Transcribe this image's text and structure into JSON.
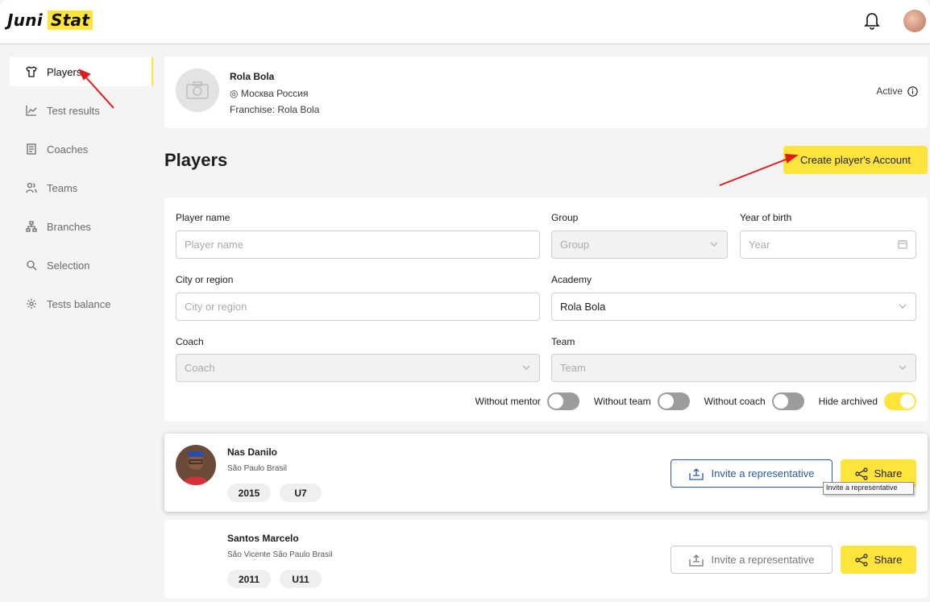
{
  "app": {
    "logo_part1": "Juni",
    "logo_part2": "Stat"
  },
  "topbar": {
    "bell_icon": "bell-icon",
    "avatar_icon": "user-avatar"
  },
  "sidebar": {
    "items": [
      {
        "label": "Players",
        "icon": "shirt-icon",
        "active": true
      },
      {
        "label": "Test results",
        "icon": "chart-line-icon"
      },
      {
        "label": "Coaches",
        "icon": "clipboard-icon"
      },
      {
        "label": "Teams",
        "icon": "users-icon"
      },
      {
        "label": "Branches",
        "icon": "hierarchy-icon"
      },
      {
        "label": "Selection",
        "icon": "search-icon"
      },
      {
        "label": "Tests balance",
        "icon": "gear-icon"
      }
    ]
  },
  "academy": {
    "name": "Rola Bola",
    "location": "Москва Россия",
    "franchise": "Franchise: Rola Bola",
    "status": "Active"
  },
  "page": {
    "title": "Players",
    "create_button": "Create player's Account"
  },
  "filters": {
    "player_name": {
      "label": "Player name",
      "placeholder": "Player name"
    },
    "group": {
      "label": "Group",
      "placeholder": "Group"
    },
    "year_of_birth": {
      "label": "Year of birth",
      "placeholder": "Year"
    },
    "city": {
      "label": "City or region",
      "placeholder": "City or region"
    },
    "academy": {
      "label": "Academy",
      "value": "Rola Bola"
    },
    "coach": {
      "label": "Coach",
      "placeholder": "Coach"
    },
    "team": {
      "label": "Team",
      "placeholder": "Team"
    },
    "toggles": [
      {
        "label": "Without mentor",
        "on": false
      },
      {
        "label": "Without team",
        "on": false
      },
      {
        "label": "Without coach",
        "on": false
      },
      {
        "label": "Hide archived",
        "on": true
      }
    ]
  },
  "players": [
    {
      "name": "Nas Danilo",
      "location": "São Paulo Brasil",
      "year": "2015",
      "group": "U7",
      "invite_label": "Invite a representative",
      "share_label": "Share"
    },
    {
      "name": "Santos Marcelo",
      "location": "São Vicente São Paulo Brasil",
      "year": "2011",
      "group": "U11",
      "invite_label": "Invite a representative",
      "share_label": "Share"
    }
  ],
  "tooltip": "Invite a representative",
  "colors": {
    "accent": "#ffe53b",
    "invite_active": "#2a5ba8",
    "annotation": "#e01b1b"
  }
}
